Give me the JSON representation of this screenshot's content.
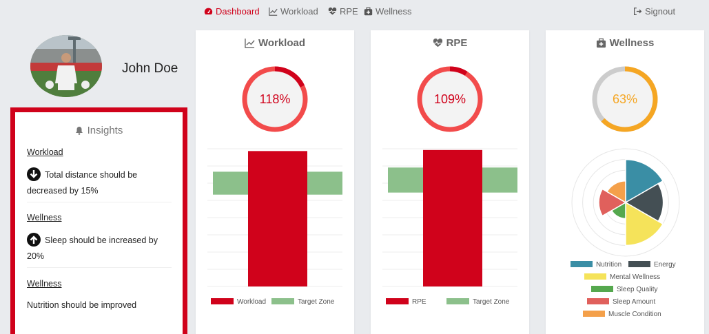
{
  "nav": {
    "dashboard": "Dashboard",
    "workload": "Workload",
    "rpe": "RPE",
    "wellness": "Wellness",
    "signout": "Signout"
  },
  "profile": {
    "name": "John Doe"
  },
  "insights": {
    "title": "Insights",
    "items": [
      {
        "heading": "Workload",
        "text": "Total distance should be decreased by 15%",
        "icon": "arrow-down-circle-icon"
      },
      {
        "heading": "Wellness",
        "text": "Sleep should be increased by 20%",
        "icon": "arrow-up-circle-icon"
      },
      {
        "heading": "Wellness",
        "text": "Nutrition should be improved",
        "icon": ""
      }
    ]
  },
  "cards": {
    "workload": {
      "title": "Workload",
      "gauge_label": "118%",
      "gauge_value": 118
    },
    "rpe": {
      "title": "RPE",
      "gauge_label": "109%",
      "gauge_value": 109
    },
    "wellness": {
      "title": "Wellness",
      "gauge_label": "63%",
      "gauge_value": 63
    }
  },
  "colors": {
    "accent": "#d0021b",
    "gauge_red": "#f24b4b",
    "gauge_orange": "#f5a623",
    "target_zone": "#8cc08b",
    "bar": "#d0021b"
  },
  "chart_data": [
    {
      "type": "bar",
      "categories": [
        "Workload"
      ],
      "series": [
        {
          "name": "Workload",
          "values": [
            118
          ]
        }
      ],
      "target_zone": {
        "name": "Target Zone",
        "range": [
          80,
          100
        ]
      },
      "ylim": [
        0,
        120
      ],
      "legend": [
        "Workload",
        "Target Zone"
      ],
      "legend_position": "bottom"
    },
    {
      "type": "bar",
      "categories": [
        "RPE"
      ],
      "series": [
        {
          "name": "RPE",
          "values": [
            109
          ]
        }
      ],
      "target_zone": {
        "name": "Target Zone",
        "range": [
          75,
          95
        ]
      },
      "ylim": [
        0,
        110
      ],
      "legend": [
        "RPE",
        "Target Zone"
      ],
      "legend_position": "bottom"
    },
    {
      "type": "polarArea",
      "categories": [
        "Nutrition",
        "Energy",
        "Mental Wellness",
        "Sleep Quality",
        "Sleep Amount",
        "Muscle Condition"
      ],
      "values": [
        4,
        3.5,
        4,
        1.5,
        2.5,
        2.0
      ],
      "max": 5,
      "colors": [
        "#3a8ea5",
        "#444f54",
        "#f5e35a",
        "#55a84e",
        "#e0605c",
        "#f4a04a"
      ],
      "legend_position": "bottom"
    }
  ]
}
